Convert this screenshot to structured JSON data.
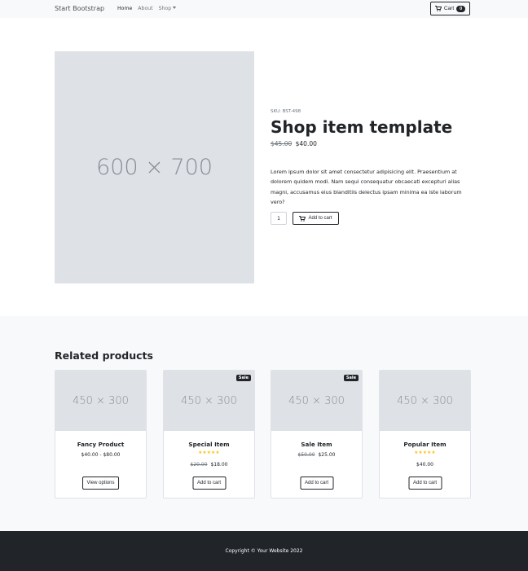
{
  "navbar": {
    "brand": "Start Bootstrap",
    "links": [
      "Home",
      "About",
      "Shop"
    ],
    "cart_label": "Cart",
    "cart_count": "0"
  },
  "product": {
    "image_placeholder": "600 × 700",
    "sku": "SKU: BST-498",
    "title": "Shop item template",
    "old_price": "$45.00",
    "price": "$40.00",
    "description": "Lorem ipsum dolor sit amet consectetur adipisicing elit. Praesentium at dolorem quidem modi. Nam sequi consequatur obcaecati excepturi alias magni, accusamus eius blanditiis delectus ipsam minima ea iste laborum vero?",
    "quantity": "1",
    "add_to_cart": "Add to cart"
  },
  "related": {
    "title": "Related products",
    "cards": [
      {
        "image_placeholder": "450 × 300",
        "name": "Fancy Product",
        "price_range": "$40.00 - $80.00",
        "button": "View options"
      },
      {
        "image_placeholder": "450 × 300",
        "name": "Special Item",
        "badge": "Sale",
        "rating": 5,
        "stars": "★★★★★",
        "old_price": "$20.00",
        "price": "$18.00",
        "button": "Add to cart"
      },
      {
        "image_placeholder": "450 × 300",
        "name": "Sale Item",
        "badge": "Sale",
        "old_price": "$50.00",
        "price": "$25.00",
        "button": "Add to cart"
      },
      {
        "image_placeholder": "450 × 300",
        "name": "Popular Item",
        "rating": 5,
        "stars": "★★★★★",
        "price": "$40.00",
        "button": "Add to cart"
      }
    ]
  },
  "footer": {
    "copyright": "Copyright © Your Website 2022"
  },
  "colors": {
    "dark": "#212529",
    "light_bg": "#f8f9fa",
    "placeholder": "#dee2e6",
    "star": "#ffc107"
  }
}
